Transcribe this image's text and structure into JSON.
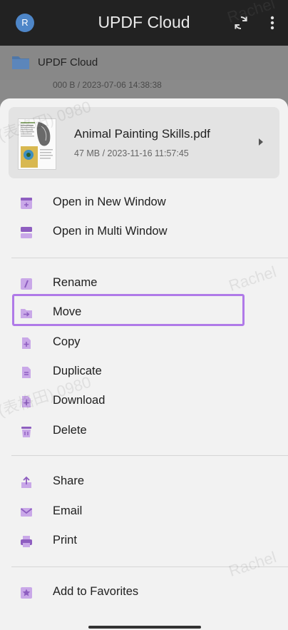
{
  "appbar": {
    "avatar_letter": "R",
    "title": "UPDF Cloud"
  },
  "background": {
    "folder_title": "UPDF Cloud",
    "ghost_meta": "000 B / 2023-07-06 14:38:38"
  },
  "file": {
    "name": "Animal Painting Skills.pdf",
    "meta": "47 MB / 2023-11-16 11:57:45"
  },
  "menu": {
    "open_new_window": "Open in New Window",
    "open_multi_window": "Open in Multi Window",
    "rename": "Rename",
    "move": "Move",
    "copy": "Copy",
    "duplicate": "Duplicate",
    "download": "Download",
    "delete": "Delete",
    "share": "Share",
    "email": "Email",
    "print": "Print",
    "add_favorites": "Add to Favorites"
  },
  "colors": {
    "accent": "#8e5ec0",
    "accent_light": "#c9a8e8",
    "highlight": "#b07ae8"
  },
  "watermarks": [
    "Rachel",
    "(表格田) 0980",
    "Rachel",
    "(表格田) 0980",
    "Rachel"
  ]
}
